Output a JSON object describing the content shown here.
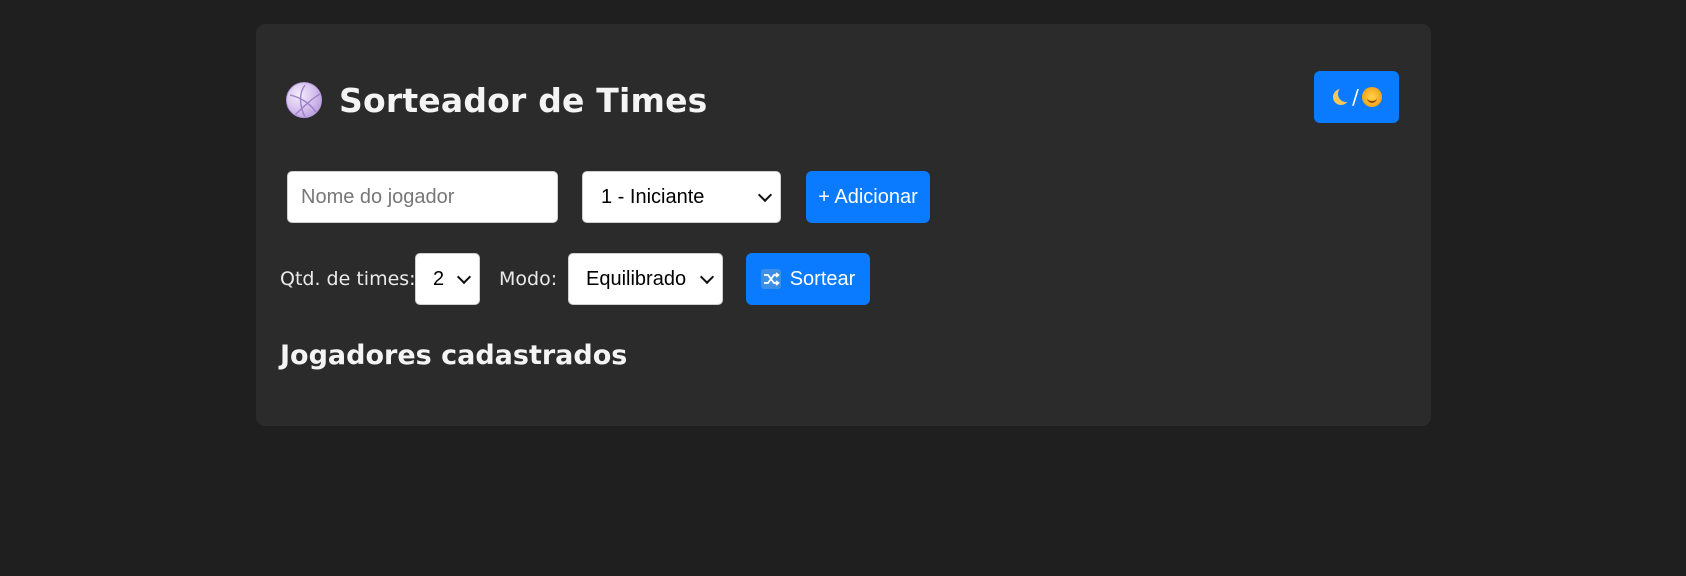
{
  "header": {
    "title": "Sorteador de Times",
    "logo_icon": "volleyball-icon",
    "theme_toggle_icons": [
      "moon-icon",
      "sun-icon"
    ],
    "theme_toggle_separator": "/"
  },
  "add_player": {
    "name_placeholder": "Nome do jogador",
    "name_value": "",
    "level_selected": "1 - Iniciante",
    "add_button_label": "+ Adicionar"
  },
  "draw": {
    "teams_label": "Qtd. de times:",
    "teams_selected": "2",
    "mode_label": "Modo:",
    "mode_selected": "Equilibrado",
    "draw_button_label": "Sortear",
    "draw_button_icon": "shuffle-icon"
  },
  "players_section": {
    "title": "Jogadores cadastrados"
  },
  "colors": {
    "background": "#1f1f1f",
    "card": "#2b2b2b",
    "accent": "#0a7bff"
  }
}
